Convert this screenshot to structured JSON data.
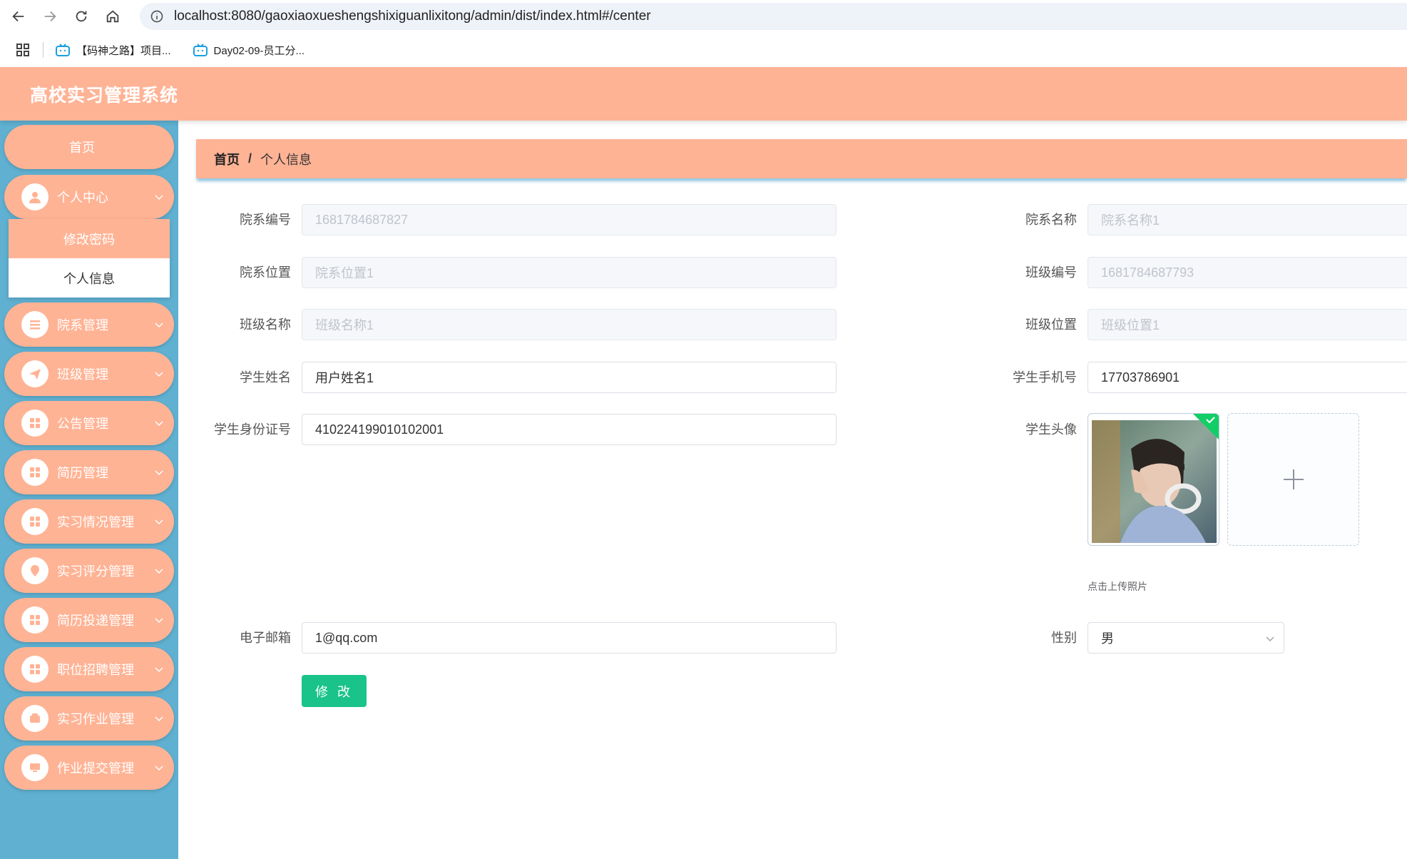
{
  "browser": {
    "url": "localhost:8080/gaoxiaoxueshengshixiguanlixitong/admin/dist/index.html#/center",
    "bookmarks": [
      "【码神之路】项目...",
      "Day02-09-员工分..."
    ]
  },
  "header": {
    "title": "高校实习管理系统"
  },
  "sidebar": {
    "home": "首页",
    "personal_center": "个人中心",
    "submenu": [
      "修改密码",
      "个人信息"
    ],
    "items": [
      "院系管理",
      "班级管理",
      "公告管理",
      "简历管理",
      "实习情况管理",
      "实习评分管理",
      "简历投递管理",
      "职位招聘管理",
      "实习作业管理",
      "作业提交管理"
    ]
  },
  "breadcrumb": {
    "home": "首页",
    "separator": "/",
    "current": "个人信息"
  },
  "form": {
    "fields": {
      "dept_id": {
        "label": "院系编号",
        "value": "1681784687827"
      },
      "dept_name": {
        "label": "院系名称",
        "value": "院系名称1"
      },
      "dept_location": {
        "label": "院系位置",
        "value": "院系位置1"
      },
      "class_id": {
        "label": "班级编号",
        "value": "1681784687793"
      },
      "class_name": {
        "label": "班级名称",
        "value": "班级名称1"
      },
      "class_location": {
        "label": "班级位置",
        "value": "班级位置1"
      },
      "student_name": {
        "label": "学生姓名",
        "value": "用户姓名1"
      },
      "student_phone": {
        "label": "学生手机号",
        "value": "17703786901"
      },
      "student_idcard": {
        "label": "学生身份证号",
        "value": "410224199010102001"
      },
      "student_avatar": {
        "label": "学生头像"
      },
      "email": {
        "label": "电子邮箱",
        "value": "1@qq.com"
      },
      "gender": {
        "label": "性别",
        "value": "男"
      }
    },
    "upload_hint": "点击上传照片",
    "submit_label": "修 改"
  },
  "colors": {
    "accent": "#ffb395",
    "sidebar_bg": "#5fb0d1",
    "submit": "#19c389"
  }
}
